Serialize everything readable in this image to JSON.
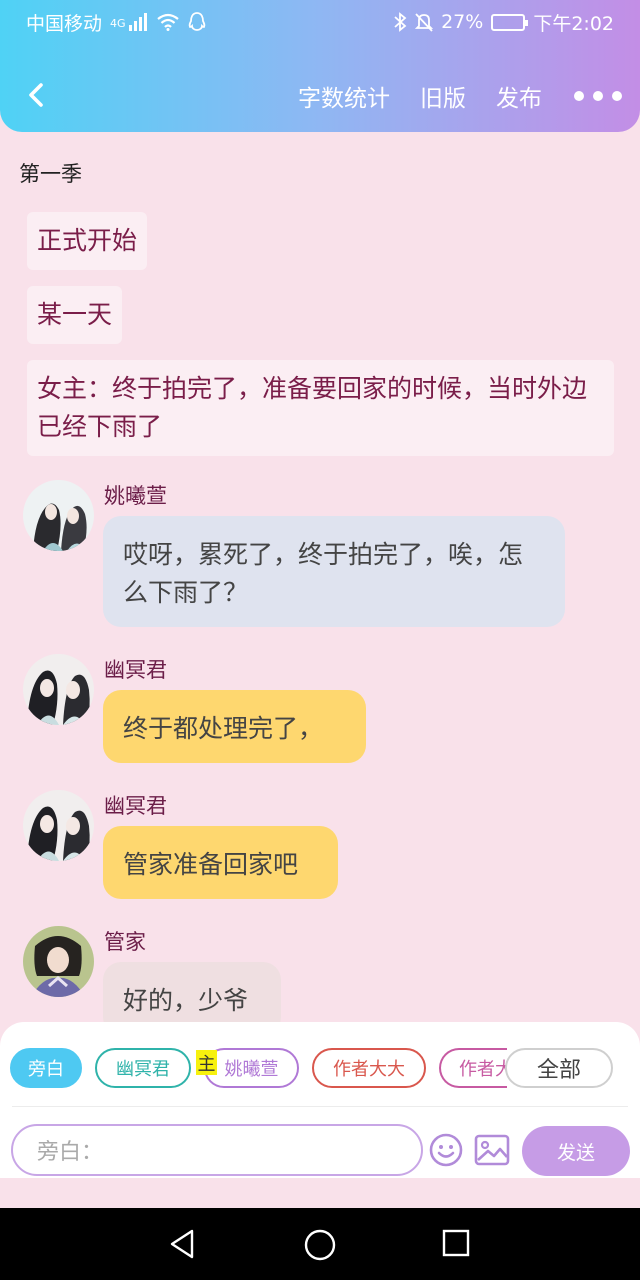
{
  "status_bar": {
    "carrier": "中国移动",
    "network": "4G",
    "battery_pct": "27%",
    "time": "下午2:02"
  },
  "nav": {
    "word_count_label": "字数统计",
    "old_version_label": "旧版",
    "publish_label": "发布"
  },
  "story": {
    "section_title": "第一季",
    "narrations": [
      "正式开始",
      "某一天",
      "女主：终于拍完了，准备要回家的时候，当时外边已经下雨了"
    ],
    "messages": [
      {
        "name": "姚曦萱",
        "text": "哎呀，累死了，终于拍完了，唉，怎么下雨了？"
      },
      {
        "name": "幽冥君",
        "text": "终于都处理完了，"
      },
      {
        "name": "幽冥君",
        "text": "管家准备回家吧"
      },
      {
        "name": "管家",
        "text": "好的，少爷"
      }
    ]
  },
  "roles": {
    "items": [
      "旁白",
      "幽冥君",
      "姚曦萱",
      "作者大大",
      "作者大"
    ],
    "host_badge": "主",
    "all_label": "全部"
  },
  "composer": {
    "placeholder": "旁白：",
    "send_label": "发送"
  },
  "colors": {
    "accent_blue": "#4ec9f2",
    "accent_purple": "#c69ce6",
    "narration_text": "#7a1d49",
    "page_bg": "#f9e1ea"
  }
}
